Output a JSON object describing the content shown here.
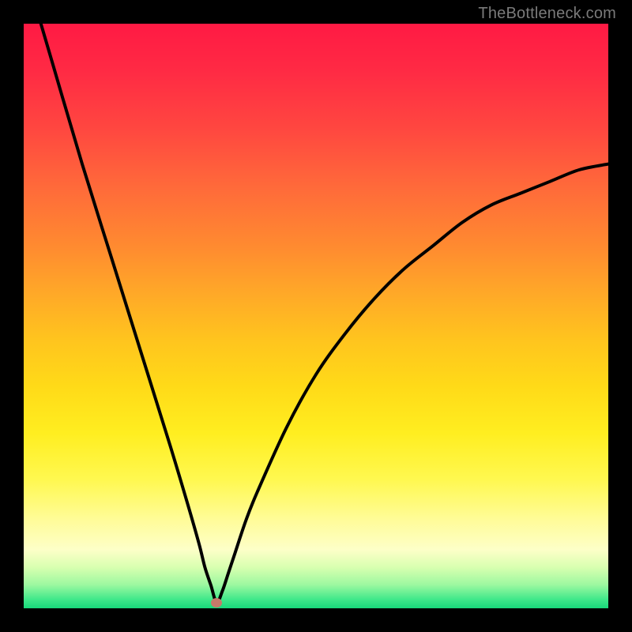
{
  "watermark": "TheBottleneck.com",
  "colors": {
    "frame": "#000000",
    "curve": "#000000",
    "marker": "#c77a6a",
    "gradient_top": "#ff1a44",
    "gradient_bottom": "#18d87a"
  },
  "chart_data": {
    "type": "line",
    "title": "",
    "xlabel": "",
    "ylabel": "",
    "xlim": [
      0,
      100
    ],
    "ylim": [
      0,
      100
    ],
    "grid": false,
    "legend": false,
    "annotations": [
      {
        "name": "marker",
        "x": 33,
        "y": 1,
        "label": ""
      }
    ],
    "series": [
      {
        "name": "bottleneck-curve",
        "x": [
          0,
          5,
          10,
          15,
          20,
          25,
          28,
          30,
          31,
          32,
          33,
          34,
          35,
          36,
          38,
          40,
          45,
          50,
          55,
          60,
          65,
          70,
          75,
          80,
          85,
          90,
          95,
          100
        ],
        "values": [
          110,
          93,
          76,
          60,
          44,
          28,
          18,
          11,
          7,
          4,
          1,
          3,
          6,
          9,
          15,
          20,
          31,
          40,
          47,
          53,
          58,
          62,
          66,
          69,
          71,
          73,
          75,
          76
        ]
      }
    ]
  }
}
